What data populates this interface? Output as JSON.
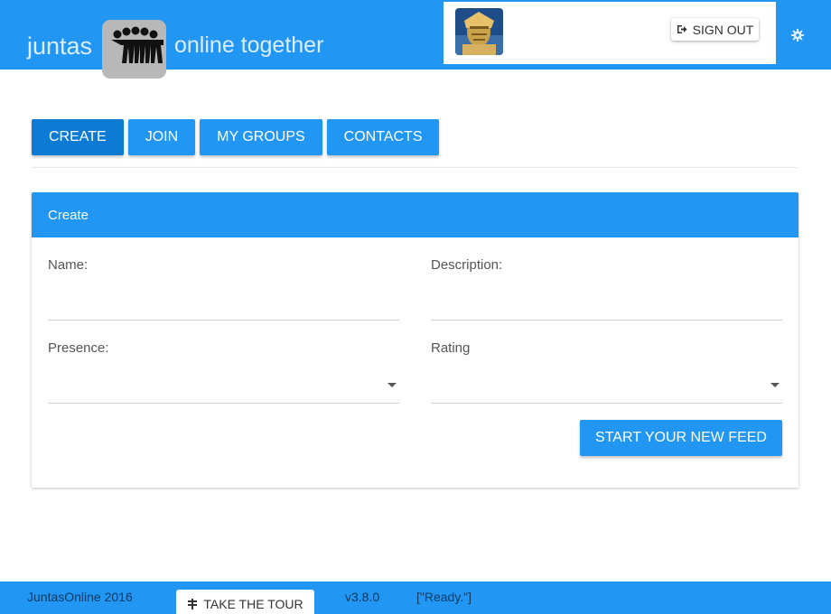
{
  "header": {
    "brand_left": "juntas",
    "brand_right": "online together",
    "signout_label": "SIGN OUT",
    "settings_icon": "gear-icon",
    "avatar_icon": "user-avatar"
  },
  "tabs": [
    {
      "label": "CREATE",
      "active": true
    },
    {
      "label": "JOIN",
      "active": false
    },
    {
      "label": "MY GROUPS",
      "active": false
    },
    {
      "label": "CONTACTS",
      "active": false
    }
  ],
  "card": {
    "title": "Create",
    "fields": {
      "name": {
        "label": "Name:",
        "value": ""
      },
      "description": {
        "label": "Description:",
        "value": ""
      },
      "presence": {
        "label": "Presence:",
        "value": ""
      },
      "rating": {
        "label": "Rating",
        "value": ""
      }
    },
    "submit_label": "START YOUR NEW FEED"
  },
  "footer": {
    "copyright": "JuntasOnline 2016",
    "tour_label": "TAKE THE TOUR",
    "version": "v3.8.0",
    "status": "[\"Ready.\"]"
  },
  "colors": {
    "primary": "#2196f3",
    "primary_dark": "#0d7ad3",
    "footer_text": "#0c3a63"
  }
}
